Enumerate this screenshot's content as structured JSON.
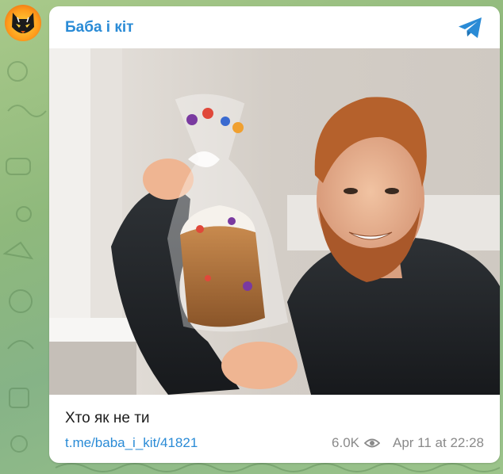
{
  "channel": {
    "name": "Баба і кіт"
  },
  "post": {
    "caption": "Хто як не ти",
    "link": "t.me/baba_i_kit/41821",
    "views": "6.0K",
    "date": "Apr 11 at 22:28"
  },
  "colors": {
    "accent": "#2a8bd6",
    "meta": "#8a8a8a",
    "card_bg": "#ffffff",
    "chat_bg": "#9cc48a"
  },
  "icons": {
    "brand": "telegram-icon",
    "views": "eye-icon"
  }
}
